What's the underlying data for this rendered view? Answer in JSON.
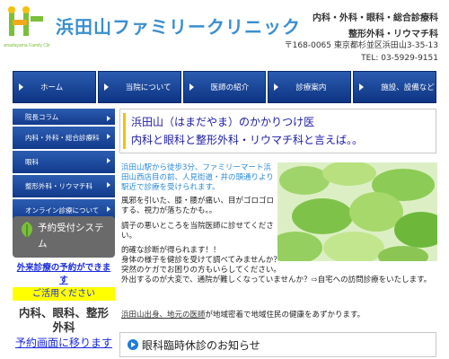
{
  "header": {
    "clinic_name": "浜田山ファミリークリニック",
    "departments_line1": "内科・外科・眼科・総合診療科",
    "departments_line2": "整形外科・リウマチ科",
    "postal": "〒168-0065 東京都杉並区浜田山3-35-13",
    "tel": "TEL: 03-5929-9151"
  },
  "nav": [
    {
      "label": "ホーム"
    },
    {
      "label": "当院について"
    },
    {
      "label": "医師の紹介"
    },
    {
      "label": "診療案内"
    },
    {
      "label": "施設、設備など"
    }
  ],
  "sidebar": [
    {
      "label": "院長コラム"
    },
    {
      "label": "内科・外科・総合診療科"
    },
    {
      "label": "眼科"
    },
    {
      "label": "整形外科・リウマチ科"
    },
    {
      "label": "オンライン診療について"
    }
  ],
  "reservation": {
    "title": "予約受付システム",
    "phone_line1": "外来診療の予約ができま",
    "phone_line2": "す",
    "note": "ご活用ください",
    "depts_line1": "内科、眼科、整形",
    "depts_line2": "外科",
    "link": "予約画面に移ります"
  },
  "main": {
    "headline1": "浜田山（はまだやま）のかかりつけ医",
    "headline2": "内科と眼科と整形外科・リウマチ科と言えば。。",
    "intro": "浜田山駅から徒歩3分、ファミリーマート浜田山西店目の前、人見街道・井の頭通りより駅近で診療を受けられます。",
    "p1": "風邪を引いた、膝・腰が痛い、目がゴロゴロする、視力が落ちたかも。。",
    "p2": "調子の悪いところを当院医師に診せてください。",
    "p3": "的確な診断が得られます！！",
    "p4": "身体の様子を健診を受けて調べてみませんか？\n突然のケガでお困りの方もいらしてください。\n外出するのが大変で、通院が難しくなっていませんか？⇨自宅への訪問診療をいたします。",
    "p6_underlined": "浜田山出身、地元の医師",
    "p6_rest": "が地域密着で地域住民の健康をあずかります。",
    "notice": "眼科臨時休診のお知らせ"
  },
  "colors": {
    "accent": "#3a8fd0",
    "nav_bg": "#1a4597",
    "headline_text": "#1a1aa8",
    "link_blue": "#1a2bdc",
    "highlight": "#ffff00"
  }
}
